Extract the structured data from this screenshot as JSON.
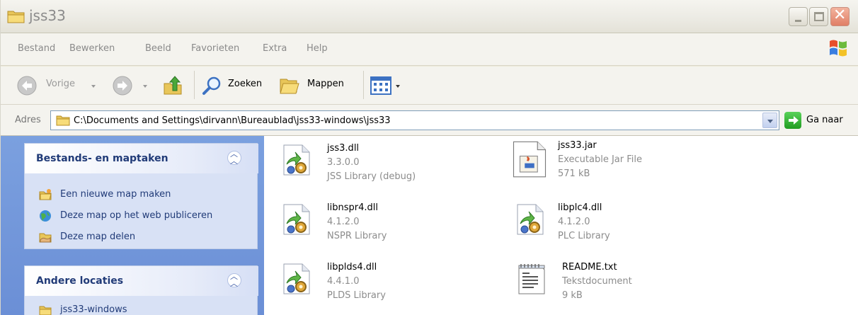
{
  "window": {
    "title": "jss33",
    "icon": "folder-icon",
    "buttons": [
      "minimize-icon",
      "maximize-icon",
      "close-icon"
    ]
  },
  "menu": {
    "items": [
      "Bestand",
      "Bewerken",
      "Beeld",
      "Favorieten",
      "Extra",
      "Help"
    ]
  },
  "toolbar": {
    "back_label": "Vorige",
    "search_label": "Zoeken",
    "folders_label": "Mappen",
    "icons": [
      "back-arrow-icon",
      "forward-arrow-icon",
      "up-folder-icon",
      "search-icon",
      "folders-icon",
      "views-icon"
    ]
  },
  "address": {
    "label": "Adres",
    "path": "C:\\Documents and Settings\\dirvann\\Bureaublad\\jss33-windows\\jss33",
    "go_label": "Ga naar"
  },
  "taskpane": {
    "file_tasks": {
      "title": "Bestands- en maptaken",
      "links": [
        {
          "label": "Een nieuwe map maken",
          "icon": "new-folder-icon"
        },
        {
          "label": "Deze map op het web publiceren",
          "icon": "web-publish-icon"
        },
        {
          "label": "Deze map delen",
          "icon": "share-folder-icon"
        }
      ]
    },
    "other_places": {
      "title": "Andere locaties",
      "links": [
        {
          "label": "jss33-windows",
          "icon": "folder-icon"
        }
      ]
    }
  },
  "files": [
    {
      "name": "jss3.dll",
      "line2": "3.3.0.0",
      "line3": "JSS Library (debug)",
      "icon": "dll-icon"
    },
    {
      "name": "jss33.jar",
      "line2": "Executable Jar File",
      "line3": "571 kB",
      "icon": "jar-icon"
    },
    {
      "name": "libnspr4.dll",
      "line2": "4.1.2.0",
      "line3": "NSPR Library",
      "icon": "dll-icon"
    },
    {
      "name": "libplc4.dll",
      "line2": "4.1.2.0",
      "line3": "PLC Library",
      "icon": "dll-icon"
    },
    {
      "name": "libplds4.dll",
      "line2": "4.4.1.0",
      "line3": "PLDS Library",
      "icon": "dll-icon"
    },
    {
      "name": "README.txt",
      "line2": "Tekstdocument",
      "line3": "9 kB",
      "icon": "text-document-icon"
    }
  ]
}
